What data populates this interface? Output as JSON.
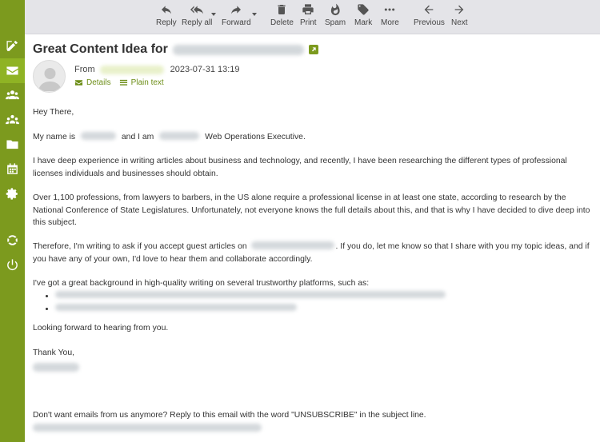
{
  "toolbar": {
    "reply": "Reply",
    "reply_all": "Reply all",
    "forward": "Forward",
    "delete": "Delete",
    "print": "Print",
    "spam": "Spam",
    "mark": "Mark",
    "more": "More",
    "previous": "Previous",
    "next": "Next"
  },
  "sidebar": {
    "items": [
      {
        "icon": "compose-icon"
      },
      {
        "icon": "mail-icon",
        "active": true
      },
      {
        "icon": "contacts-icon"
      },
      {
        "icon": "groups-icon"
      },
      {
        "icon": "folder-icon"
      },
      {
        "icon": "calendar-icon"
      },
      {
        "icon": "settings-icon"
      },
      {
        "icon": "help-icon"
      },
      {
        "icon": "logout-icon"
      }
    ]
  },
  "message": {
    "subject": "Great Content Idea for",
    "from_label": "From",
    "date": "2023-07-31 13:19",
    "details_label": "Details",
    "plain_text_label": "Plain text",
    "body": {
      "greeting": "Hey There,",
      "intro_a": "My name is",
      "intro_b": "and I am",
      "intro_c": "Web Operations Executive.",
      "p1": "I have deep experience in writing articles about business and technology, and recently, I have been researching the different types of professional licenses individuals and businesses should obtain.",
      "p2": "Over 1,100 professions, from lawyers to barbers, in the US alone require a professional license in at least one state, according to research by the National Conference of State Legislatures. Unfortunately, not everyone knows the full details about this, and that is why I have decided to dive deep into this subject.",
      "p3a": "Therefore, I'm writing to ask if you accept guest articles on",
      "p3b": ". If you do, let me know so that I share with you my topic ideas, and if you have any of your own, I'd love to hear them and collaborate accordingly.",
      "p4": "I've got a great background in high-quality writing on several trustworthy platforms, such as:",
      "closing": "Looking forward to hearing from you.",
      "thanks": "Thank You,",
      "footer": "Don't want emails from us anymore? Reply to this email with the word \"UNSUBSCRIBE\" in the subject line."
    }
  }
}
